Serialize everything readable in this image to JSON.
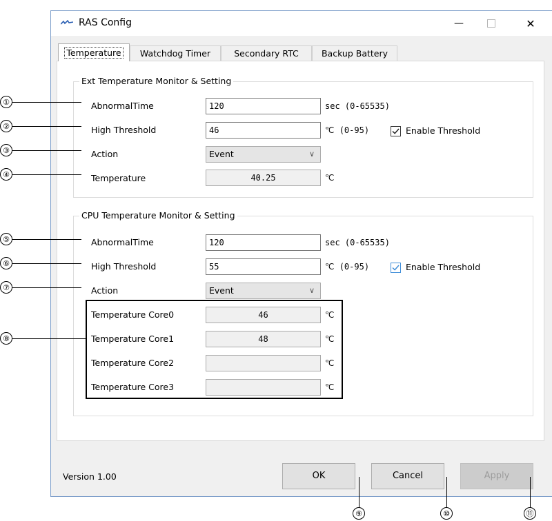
{
  "window": {
    "title": "RAS Config",
    "minimize_glyph": "—",
    "close_glyph": "✕"
  },
  "tabs": [
    {
      "label": "Temperature",
      "active": true
    },
    {
      "label": "Watchdog Timer",
      "active": false
    },
    {
      "label": "Secondary RTC",
      "active": false
    },
    {
      "label": "Backup Battery",
      "active": false
    }
  ],
  "ext_group": {
    "title": "Ext Temperature Monitor & Setting",
    "abnormal_time_label": "AbnormalTime",
    "abnormal_time_value": "120",
    "abnormal_time_unit": "sec (0-65535)",
    "high_threshold_label": "High Threshold",
    "high_threshold_value": "46",
    "high_threshold_unit": "℃ (0-95)",
    "enable_threshold_label": "Enable Threshold",
    "enable_threshold_checked": true,
    "action_label": "Action",
    "action_value": "Event",
    "temperature_label": "Temperature",
    "temperature_value": "40.25",
    "temperature_unit": "℃"
  },
  "cpu_group": {
    "title": "CPU Temperature Monitor & Setting",
    "abnormal_time_label": "AbnormalTime",
    "abnormal_time_value": "120",
    "abnormal_time_unit": "sec (0-65535)",
    "high_threshold_label": "High Threshold",
    "high_threshold_value": "55",
    "high_threshold_unit": "℃ (0-95)",
    "enable_threshold_label": "Enable Threshold",
    "enable_threshold_checked": true,
    "action_label": "Action",
    "action_value": "Event",
    "cores": [
      {
        "label": "Temperature Core0",
        "value": "46",
        "unit": "℃"
      },
      {
        "label": "Temperature Core1",
        "value": "48",
        "unit": "℃"
      },
      {
        "label": "Temperature Core2",
        "value": "",
        "unit": "℃"
      },
      {
        "label": "Temperature Core3",
        "value": "",
        "unit": "℃"
      }
    ]
  },
  "footer": {
    "version": "Version 1.00",
    "ok_label": "OK",
    "cancel_label": "Cancel",
    "apply_label": "Apply"
  },
  "callouts": [
    "①",
    "②",
    "③",
    "④",
    "⑤",
    "⑥",
    "⑦",
    "⑧",
    "⑨",
    "⑩",
    "⑪"
  ],
  "colors": {
    "window_border": "#7a9cc9",
    "checkbox_accent": "#3c8cd8",
    "disabled_text": "#9c9c9c"
  }
}
